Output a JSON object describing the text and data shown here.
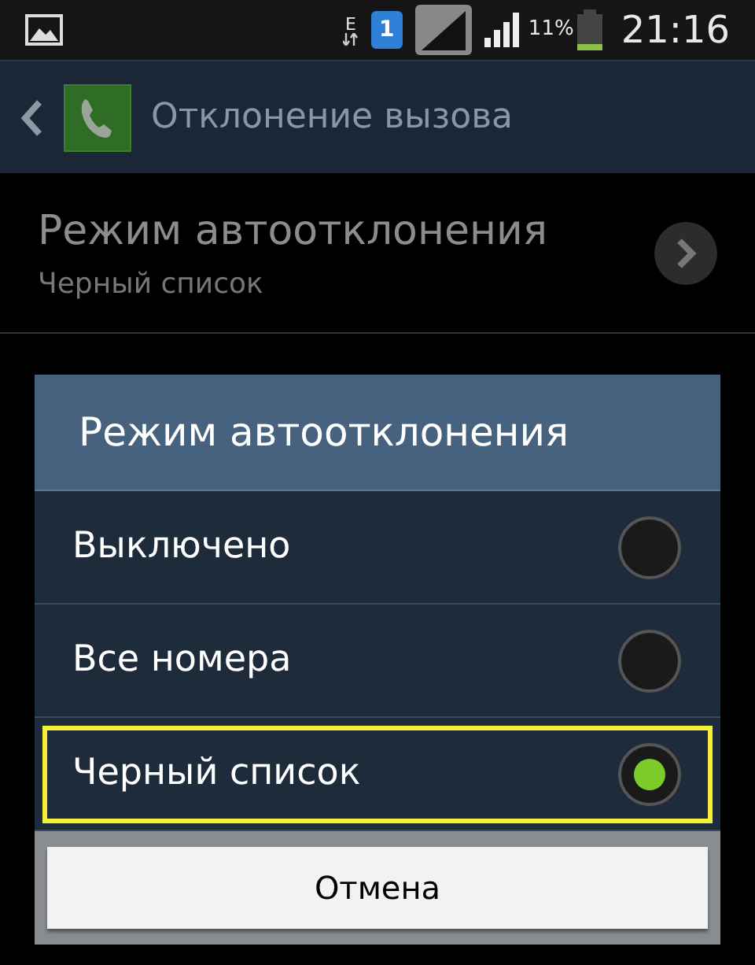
{
  "status_bar": {
    "network_type": "E",
    "sim_slot": "1",
    "battery_percent": "11%",
    "time": "21:16"
  },
  "action_bar": {
    "title": "Отклонение вызова"
  },
  "settings": [
    {
      "title": "Режим автоотклонения",
      "summary": "Черный список"
    }
  ],
  "dialog": {
    "title": "Режим автоотклонения",
    "options": [
      {
        "label": "Выключено",
        "selected": false,
        "highlighted": false
      },
      {
        "label": "Все номера",
        "selected": false,
        "highlighted": false
      },
      {
        "label": "Черный список",
        "selected": true,
        "highlighted": true
      }
    ],
    "buttons": [
      "Отмена"
    ]
  }
}
